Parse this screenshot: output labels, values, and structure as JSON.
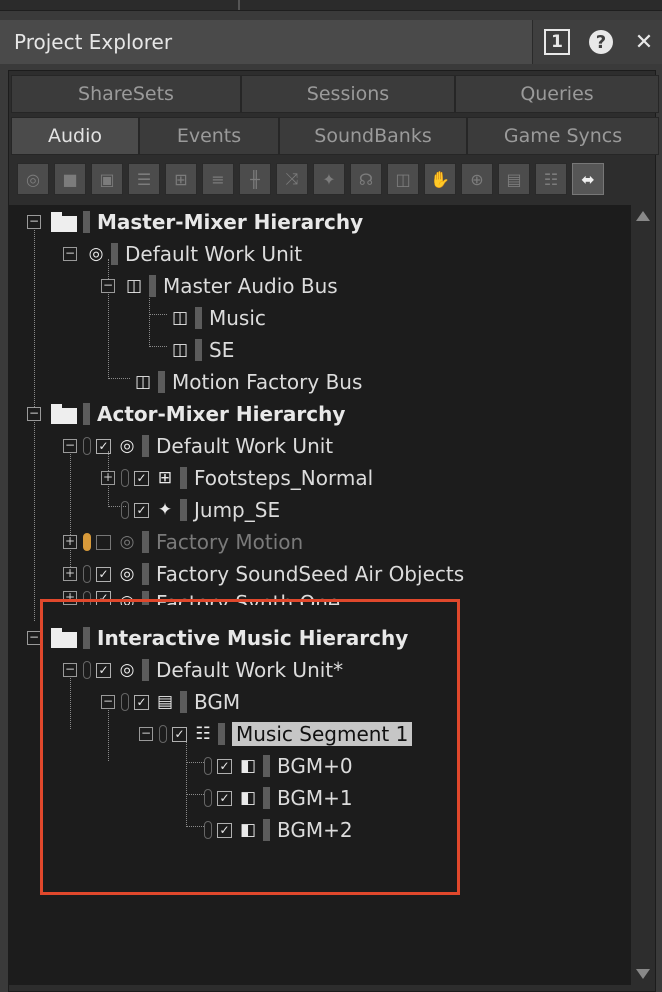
{
  "window": {
    "title": "Project Explorer",
    "buttons": {
      "num": "1",
      "help": "?",
      "close": "✕"
    }
  },
  "tabs_row1": [
    "ShareSets",
    "Sessions",
    "Queries"
  ],
  "tabs_row2": [
    "Audio",
    "Events",
    "SoundBanks",
    "Game Syncs"
  ],
  "active_tab": "Audio",
  "toolbar_icons": [
    "work-unit-icon",
    "folder-icon",
    "virtual-folder-icon",
    "switch-container-icon",
    "random-container-icon",
    "sequence-container-icon",
    "blend-container-icon",
    "shuffle-icon",
    "sound-sfx-icon",
    "voice-icon",
    "bus-icon",
    "hand-icon",
    "music-switch-icon",
    "music-playlist-icon",
    "music-segment-icon",
    "music-track-icon"
  ],
  "tree": {
    "master_mixer": "Master-Mixer Hierarchy",
    "mm_default_wu": "Default Work Unit",
    "master_audio_bus": "Master Audio Bus",
    "music": "Music",
    "se": "SE",
    "motion_factory_bus": "Motion Factory Bus",
    "actor_mixer": "Actor-Mixer Hierarchy",
    "am_default_wu": "Default Work Unit",
    "footsteps": "Footsteps_Normal",
    "jump_se": "Jump_SE",
    "factory_motion": "Factory Motion",
    "factory_soundseed": "Factory SoundSeed Air Objects",
    "factory_synth": "Factory Synth One",
    "interactive_music": "Interactive Music Hierarchy",
    "im_default_wu": "Default Work Unit*",
    "bgm": "BGM",
    "music_segment": "Music Segment 1",
    "bgm0": "BGM+0",
    "bgm1": "BGM+1",
    "bgm2": "BGM+2"
  },
  "highlight_color": "#e0482c"
}
